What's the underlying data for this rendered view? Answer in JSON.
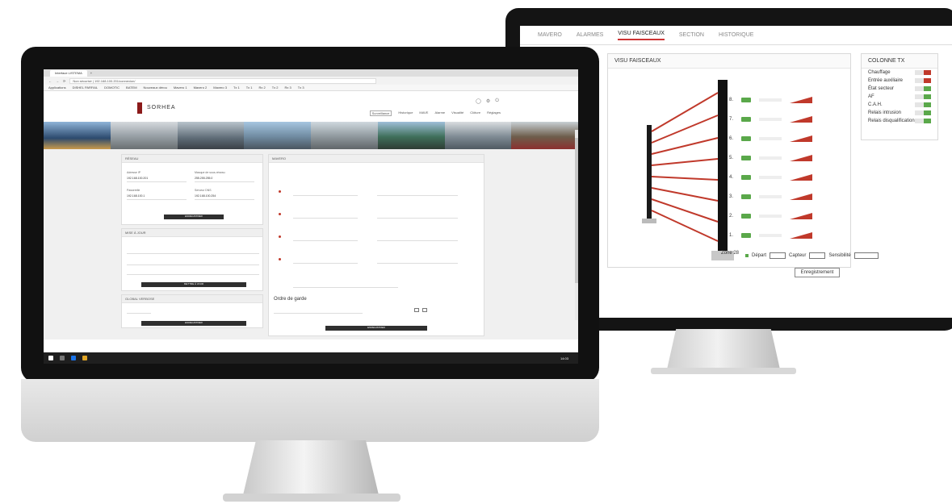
{
  "back": {
    "nav": [
      "MAVERO",
      "ALARMES",
      "VISU FAISCEAUX",
      "SECTION",
      "HISTORIQUE"
    ],
    "visu_title": "VISU FAISCEAUX",
    "beam_numbers": [
      "8.",
      "7.",
      "6.",
      "5.",
      "4.",
      "3.",
      "2.",
      "1."
    ],
    "colonne_title": "COLONNE TX",
    "status": [
      {
        "label": "Chauffage",
        "color": "#c0392b"
      },
      {
        "label": "Entrée auxiliaire",
        "color": "#c0392b"
      },
      {
        "label": "État secteur",
        "color": "#5aa84a"
      },
      {
        "label": "AF",
        "color": "#5aa84a"
      },
      {
        "label": "C.A.H.",
        "color": "#5aa84a"
      },
      {
        "label": "Relais intrusion",
        "color": "#5aa84a"
      },
      {
        "label": "Relais disqualification",
        "color": "#5aa84a"
      }
    ],
    "zone_label": "Zone 28",
    "depart": "Départ",
    "capteur": "Capteur",
    "sensibilite": "Sensibilité",
    "validate_button": "Enregistrement"
  },
  "front": {
    "browser_tab": "Interface LISTEMA",
    "url": "Non sécurisé | 192.168.100.201/connexion/",
    "bookmarks": [
      "Applications",
      "DISHEL PARFAIL",
      "DOMOTIC",
      "BATEM",
      "Nouveaux dérou",
      "Mavero 1",
      "Mavero 2",
      "Mavero 3",
      "Tx 1",
      "Tx 1",
      "Rx 2",
      "Tx 2",
      "Rx 3",
      "Tx 3"
    ],
    "logo_text": "SORHEA",
    "menu": [
      "Surveillance",
      "Historique",
      "MAVE",
      "Alarme",
      "Visualité",
      "Clôture",
      "Réglages"
    ],
    "active_menu": "Surveillance",
    "cards": {
      "reseau": "RÉSEAU",
      "mise_a_jour": "MISE À JOUR",
      "global_verbose": "GLOBAL VERBOSE",
      "mavero": "MAVERO"
    },
    "reseau_fields": [
      "Adresse IP",
      "Masque de sous-réseau",
      "Passerelle",
      "Serveur DNS"
    ],
    "reseau_values": [
      "192.168.100.201",
      "255.255.255.0",
      "192.168.100.1",
      "192.168.100.254"
    ],
    "update_button": "METTRE À JOUR",
    "ordre_de_garde": "Ordre de garde",
    "save_button": "ENREGISTRER",
    "taskbar_time": "14:03"
  }
}
